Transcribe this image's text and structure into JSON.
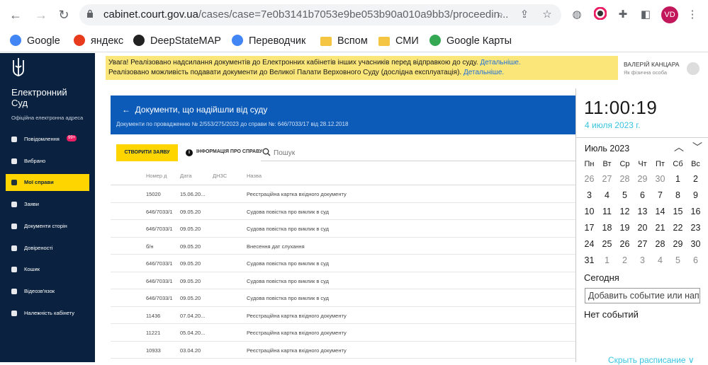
{
  "browser": {
    "url_host": "cabinet.court.gov.ua",
    "url_path": "/cases/case=7e0b3141b7053e9be053b90a010a9bb3/proceedin...",
    "profile_initials": "VD"
  },
  "bookmarks": [
    {
      "label": "Google",
      "icon": "google-icon",
      "color": "#4285f4"
    },
    {
      "label": "яндекс",
      "icon": "yandex-icon",
      "color": "#e83a1c"
    },
    {
      "label": "DeepStateMAP",
      "icon": "deepstate-icon",
      "color": "#222222"
    },
    {
      "label": "Переводчик",
      "icon": "translate-icon",
      "color": "#4285f4"
    },
    {
      "label": "Вспом",
      "icon": "folder-icon",
      "color": "#f4c542"
    },
    {
      "label": "СМИ",
      "icon": "folder-icon",
      "color": "#f4c542"
    },
    {
      "label": "Google Карты",
      "icon": "maps-icon",
      "color": "#34a853"
    }
  ],
  "sidebar": {
    "brand_line1": "Електронний",
    "brand_line2": "Суд",
    "brand_sub": "Офіційна електронна адреса",
    "items": [
      {
        "label": "Повідомлення",
        "icon": "message-icon",
        "badge": "99+"
      },
      {
        "label": "Вибрано",
        "icon": "star-icon",
        "badge": ""
      },
      {
        "label": "Мої справи",
        "icon": "folder-icon",
        "badge": "",
        "active": true
      },
      {
        "label": "Заяви",
        "icon": "list-icon",
        "badge": ""
      },
      {
        "label": "Документи сторін",
        "icon": "checklist-icon",
        "badge": ""
      },
      {
        "label": "Довіреності",
        "icon": "people-icon",
        "badge": ""
      },
      {
        "label": "Кошик",
        "icon": "trash-icon",
        "badge": ""
      },
      {
        "label": "Відеозв'язок",
        "icon": "video-icon",
        "badge": ""
      },
      {
        "label": "Належність кабінету",
        "icon": "person-icon",
        "badge": ""
      }
    ]
  },
  "notice": {
    "line1": "Увага! Реалізовано надсилання документів до Електронних кабінетів інших учасників перед відправкою до суду.",
    "line1_link": "Детальніше.",
    "line2": "Реалізовано можливість подавати документи до Великої Палати Верховного Суду (дослідна експлуатація).",
    "line2_link": "Детальніше."
  },
  "user": {
    "name": "ВАЛЕРІЙ КАНЦАРА",
    "role": "Як фізична особа"
  },
  "header": {
    "title": "Документи, що надійшли від суду",
    "subtitle": "Документи по провадженню № 2/553/275/2023 до справи №: 646/7033/17 від 28.12.2018"
  },
  "toolbar": {
    "create_label": "СТВОРИТИ ЗАЯВУ",
    "info_label": "ІНФОРМАЦІЯ ПРО СПРАВУ",
    "search_placeholder": "Пошук"
  },
  "table": {
    "columns": [
      "Номер д",
      "Дата",
      "ДНЗС",
      "Назва"
    ],
    "rows": [
      [
        "15020",
        "15.06.20...",
        "",
        "Реєстраційна картка вхідного документу"
      ],
      [
        "646/7033/1",
        "09.05.20",
        "",
        "Судова повістка про виклик в суд"
      ],
      [
        "646/7033/1",
        "09.05.20",
        "",
        "Судова повістка про виклик в суд"
      ],
      [
        "б/н",
        "09.05.20",
        "",
        "Внесення дат слухання"
      ],
      [
        "646/7033/1",
        "09.05.20",
        "",
        "Судова повістка про виклик в суд"
      ],
      [
        "646/7033/1",
        "09.05.20",
        "",
        "Судова повістка про виклик в суд"
      ],
      [
        "646/7033/1",
        "09.05.20",
        "",
        "Судова повістка про виклик в суд"
      ],
      [
        "11436",
        "07.04.20...",
        "",
        "Реєстраційна картка вхідного документу"
      ],
      [
        "11221",
        "05.04.20...",
        "",
        "Реєстраційна картка вхідного документу"
      ],
      [
        "10933",
        "03.04.20",
        "",
        "Реєстраційна картка вхідного документу"
      ]
    ]
  },
  "calendar": {
    "time": "11:00:19",
    "date": "4 июля 2023 г.",
    "month": "Июль 2023",
    "weekdays": [
      "Пн",
      "Вт",
      "Ср",
      "Чт",
      "Пт",
      "Сб",
      "Вс"
    ],
    "weeks": [
      [
        "26",
        "27",
        "28",
        "29",
        "30",
        "1",
        "2"
      ],
      [
        "3",
        "4",
        "5",
        "6",
        "7",
        "8",
        "9"
      ],
      [
        "10",
        "11",
        "12",
        "13",
        "14",
        "15",
        "16"
      ],
      [
        "17",
        "18",
        "19",
        "20",
        "21",
        "22",
        "23"
      ],
      [
        "24",
        "25",
        "26",
        "27",
        "28",
        "29",
        "30"
      ],
      [
        "31",
        "1",
        "2",
        "3",
        "4",
        "5",
        "6"
      ]
    ],
    "today_label": "Сегодня",
    "add_event": "Добавить событие или нап",
    "no_events": "Нет событий",
    "hide_link": "Скрыть расписание ∨"
  }
}
